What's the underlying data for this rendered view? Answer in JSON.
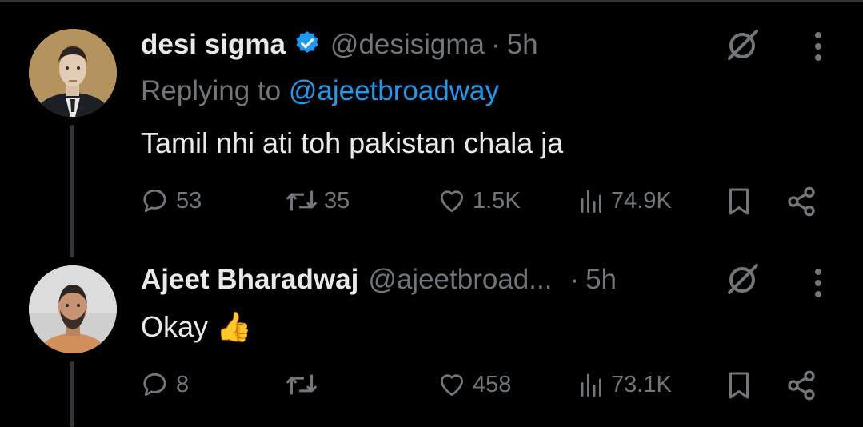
{
  "tweets": [
    {
      "name": "desi sigma",
      "verified": true,
      "handle": "@desisigma",
      "separator": "·",
      "time": "5h",
      "replying_prefix": "Replying to",
      "replying_handle": "@ajeetbroadway",
      "text": "Tamil nhi ati toh pakistan chala ja",
      "counts": {
        "replies": "53",
        "retweets": "35",
        "likes": "1.5K",
        "views": "74.9K"
      }
    },
    {
      "name": "Ajeet Bharadwaj",
      "verified": false,
      "handle": "@ajeetbroad...",
      "separator": "·",
      "time": "5h",
      "text": "Okay 👍",
      "counts": {
        "replies": "8",
        "retweets": "",
        "likes": "458",
        "views": "73.1K"
      }
    }
  ],
  "colors": {
    "background": "#000000",
    "text": "#e7e9ea",
    "muted": "#71767b",
    "accent": "#1d9bf0"
  },
  "icons": [
    "verified-badge-icon",
    "grok-icon",
    "more-icon",
    "reply-icon",
    "retweet-icon",
    "like-icon",
    "views-icon",
    "bookmark-icon",
    "share-icon"
  ]
}
